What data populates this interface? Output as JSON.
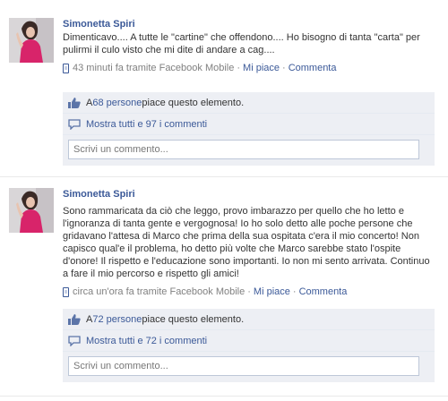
{
  "posts": [
    {
      "author": "Simonetta Spiri",
      "message": "Dimenticavo.... A tutte le \"cartine\" che offendono.... Ho bisogno di tanta \"carta\" per pulirmi il culo visto che mi dite di andare a cag....",
      "time": "43 minuti fa tramite Facebook Mobile",
      "like_action": "Mi piace",
      "comment_action": "Commenta",
      "likes_prefix": "A ",
      "likes_count": "68 persone",
      "likes_suffix": " piace questo elemento.",
      "show_comments": "Mostra tutti e 97 i commenti",
      "comment_placeholder": "Scrivi un commento..."
    },
    {
      "author": "Simonetta Spiri",
      "message": "Sono rammaricata da ciò che leggo, provo imbarazzo per quello che ho letto e l'ignoranza di tanta gente e vergognosa! Io ho solo detto alle poche persone che gridavano l'attesa di Marco che prima della sua ospitata c'era il mio concerto! Non capisco qual'e il problema, ho detto più volte che Marco sarebbe stato l'ospite d'onore! Il rispetto e l'educazione sono importanti. Io non mi sento arrivata. Continuo a fare il mio percorso e rispetto gli amici!",
      "time": "circa un'ora fa tramite Facebook Mobile",
      "like_action": "Mi piace",
      "comment_action": "Commenta",
      "likes_prefix": "A ",
      "likes_count": "72 persone",
      "likes_suffix": " piace questo elemento.",
      "show_comments": "Mostra tutti e 72 i commenti",
      "comment_placeholder": "Scrivi un commento..."
    }
  ],
  "separator": "·",
  "colors": {
    "link": "#3b5998",
    "ufi_bg": "#edeff4",
    "meta": "#808080"
  },
  "icons": [
    "avatar",
    "phone-icon",
    "like-thumb-icon",
    "comment-bubble-icon"
  ]
}
